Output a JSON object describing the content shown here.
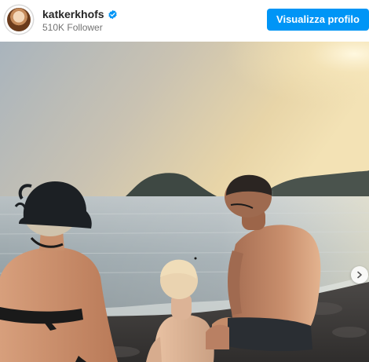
{
  "post_header": {
    "username": "katkerkhofs",
    "followers": "510K Follower",
    "view_profile_label": "Visualizza profilo",
    "verified": true
  },
  "icons": {
    "verified": "verified-badge-icon",
    "next": "chevron-right-icon"
  },
  "colors": {
    "accent": "#0095f6",
    "username": "#262626",
    "secondary_text": "#737373"
  }
}
